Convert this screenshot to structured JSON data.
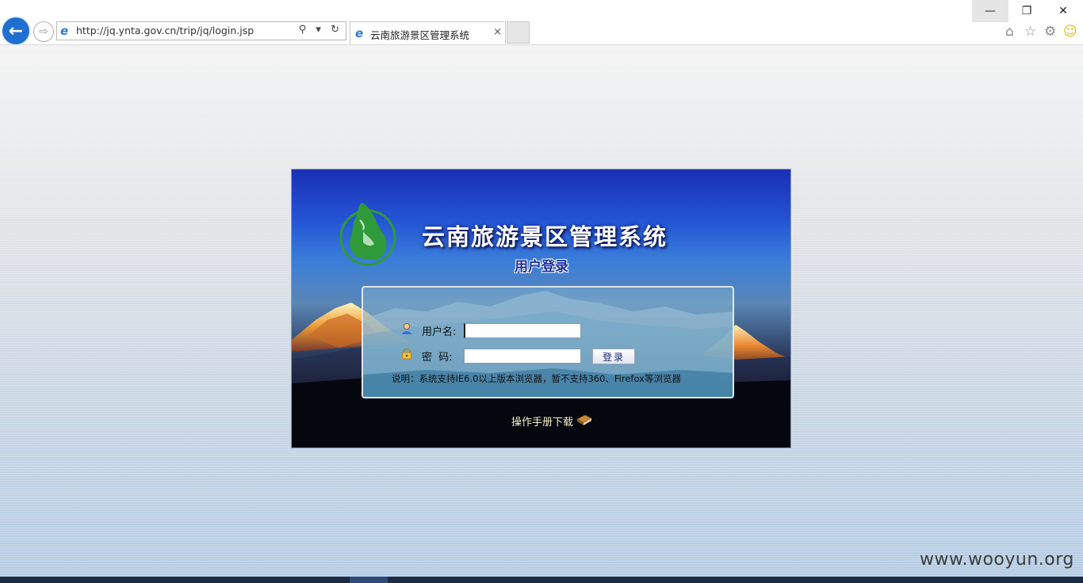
{
  "browser": {
    "url": "http://jq.ynta.gov.cn/trip/jq/login.jsp",
    "tab_title": "云南旅游景区管理系统",
    "window_controls": {
      "minimize": "—",
      "maximize": "❐",
      "close": "✕"
    },
    "icons": [
      "back-icon",
      "forward-icon",
      "ie-icon",
      "search-icon",
      "dropdown-icon",
      "refresh-icon",
      "tab-close-icon",
      "home-icon",
      "star-icon",
      "gear-icon",
      "smiley-icon"
    ],
    "address_tools": "⚲ ▾ ↻",
    "tab_close": "×",
    "back_glyph": "←",
    "forward_glyph": "⇨"
  },
  "login": {
    "system_title": "云南旅游景区管理系统",
    "subtitle": "用户登录",
    "username_label": "用户名:",
    "password_label": "密  码:",
    "username_value": "",
    "password_value": "",
    "login_button": "登录",
    "notice": "说明：系统支持IE6.0以上版本浏览器，暂不支持360、Firefox等浏览器",
    "manual_link": "操作手册下载"
  },
  "watermark": "www.wooyun.org",
  "colors": {
    "title_text": "#ffffff",
    "subtitle_text": "#1a2da8",
    "panel_sky": "#2354d4",
    "logo_green": "#2e9a3a",
    "back_button": "#1e6fd0"
  }
}
